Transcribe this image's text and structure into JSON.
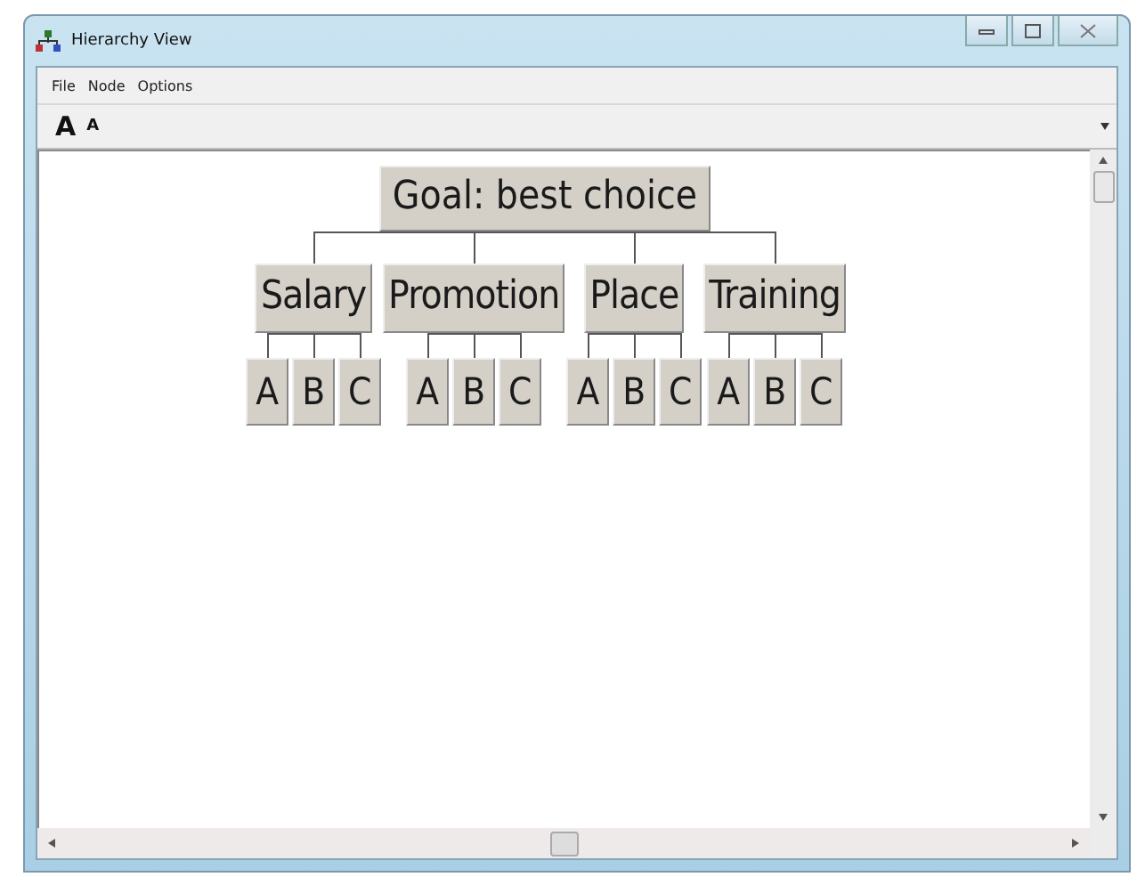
{
  "window": {
    "title": "Hierarchy View"
  },
  "menu": [
    "File",
    "Node",
    "Options"
  ],
  "toolbar": [
    {
      "label": "A",
      "kind": "grow"
    },
    {
      "label": "A",
      "kind": "shrink"
    }
  ],
  "tree": {
    "label": "Goal: best choice",
    "children": [
      {
        "label": "Salary",
        "children": [
          {
            "label": "A"
          },
          {
            "label": "B"
          },
          {
            "label": "C"
          }
        ]
      },
      {
        "label": "Promotion",
        "children": [
          {
            "label": "A"
          },
          {
            "label": "B"
          },
          {
            "label": "C"
          }
        ]
      },
      {
        "label": "Place",
        "children": [
          {
            "label": "A"
          },
          {
            "label": "B"
          },
          {
            "label": "C"
          }
        ]
      },
      {
        "label": "Training",
        "children": [
          {
            "label": "A"
          },
          {
            "label": "B"
          },
          {
            "label": "C"
          }
        ]
      }
    ]
  }
}
